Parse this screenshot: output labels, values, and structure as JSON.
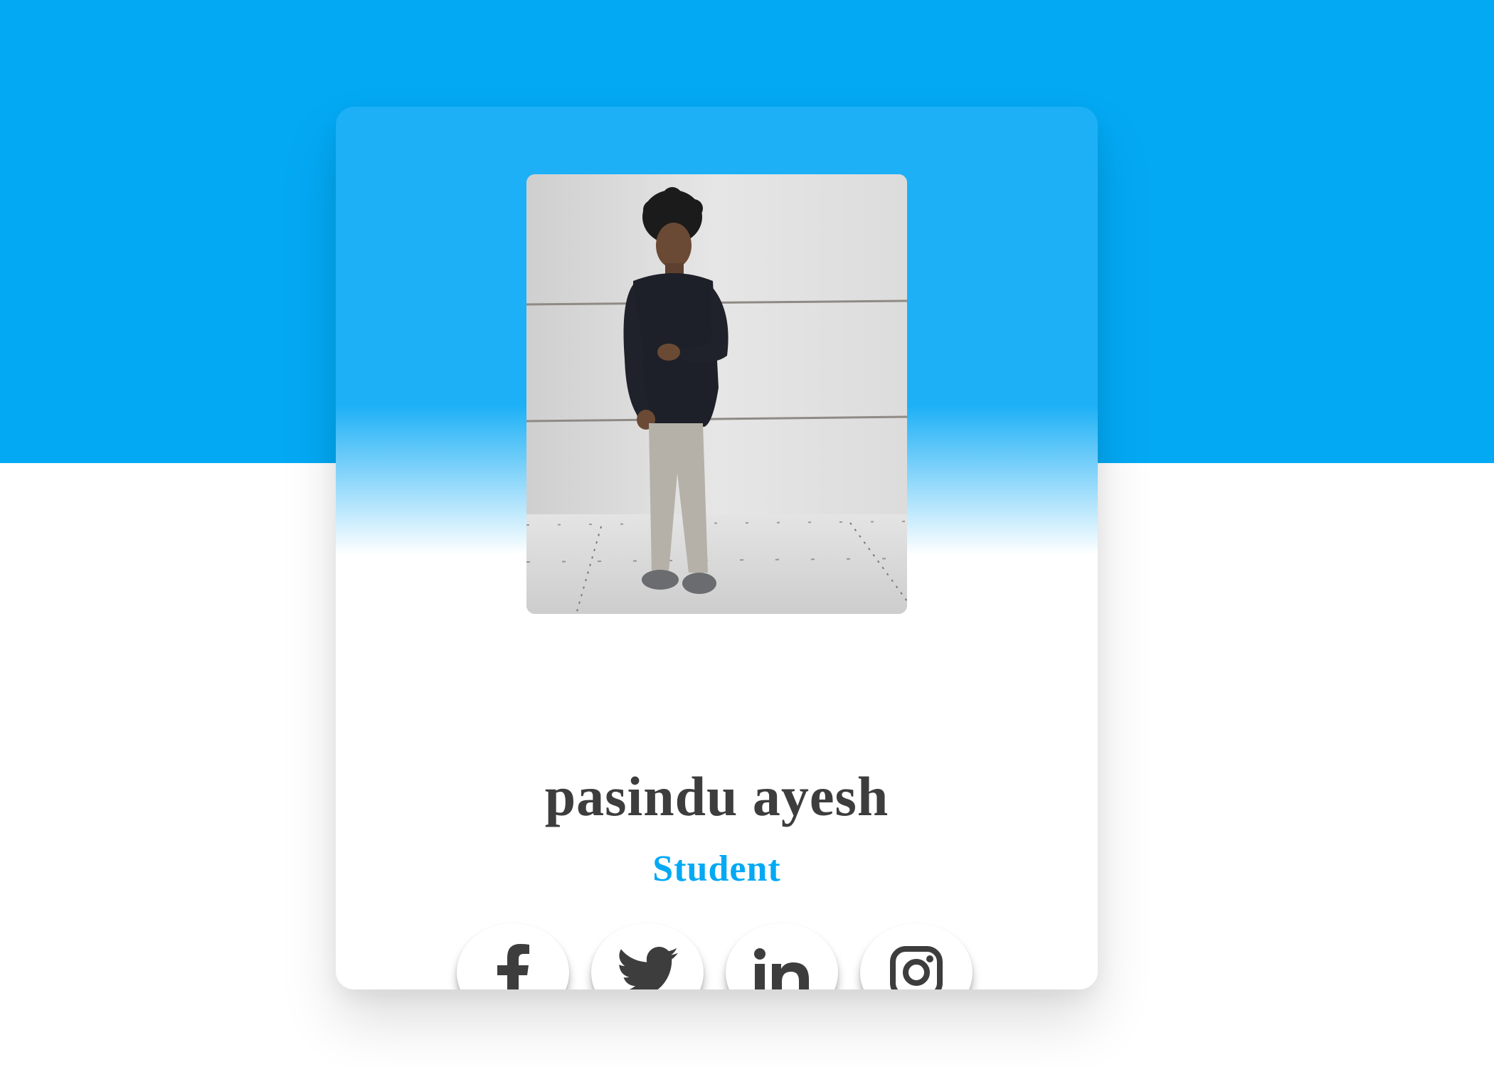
{
  "profile": {
    "name": "pasindu ayesh",
    "role": "Student",
    "photo_alt": "profile photo"
  },
  "social_links": [
    {
      "network": "facebook",
      "icon": "facebook-icon"
    },
    {
      "network": "twitter",
      "icon": "twitter-icon"
    },
    {
      "network": "linkedin",
      "icon": "linkedin-icon"
    },
    {
      "network": "instagram",
      "icon": "instagram-icon"
    }
  ],
  "colors": {
    "accent": "#04a9f4",
    "card_top": "#1db0f6",
    "text_dark": "#3d3d3d",
    "icon": "#3d3d3d"
  }
}
